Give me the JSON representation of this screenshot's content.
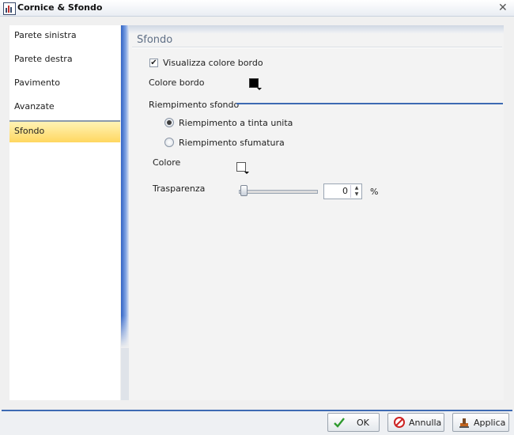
{
  "window": {
    "title": "Cornice & Sfondo",
    "close_glyph": "✕"
  },
  "nav": {
    "items": [
      {
        "label": "Parete sinistra"
      },
      {
        "label": "Parete destra"
      },
      {
        "label": "Pavimento"
      },
      {
        "label": "Avanzate"
      },
      {
        "label": "Sfondo",
        "selected": true
      }
    ]
  },
  "panel": {
    "title": "Sfondo",
    "show_border_color": {
      "label": "Visualizza colore bordo",
      "checked": true
    },
    "border_color": {
      "label": "Colore bordo",
      "swatch": "#000000"
    },
    "fill": {
      "group_label": "Riempimento sfondo",
      "options": [
        {
          "label": "Riempimento a tinta unita",
          "selected": true
        },
        {
          "label": "Riempimento sfumatura",
          "selected": false
        }
      ]
    },
    "color": {
      "label": "Colore",
      "swatch": "#ffffff"
    },
    "transparency": {
      "label": "Trasparenza",
      "value": "0",
      "unit": "%",
      "fraction": 0
    }
  },
  "footer": {
    "ok": {
      "label": "OK",
      "icon": "check-icon"
    },
    "cancel": {
      "label": "Annulla",
      "icon": "cancel-icon"
    },
    "apply": {
      "label": "Applica",
      "icon": "apply-icon"
    }
  },
  "colors": {
    "accent": "#3d6ab3",
    "selection": "#ffd760"
  }
}
